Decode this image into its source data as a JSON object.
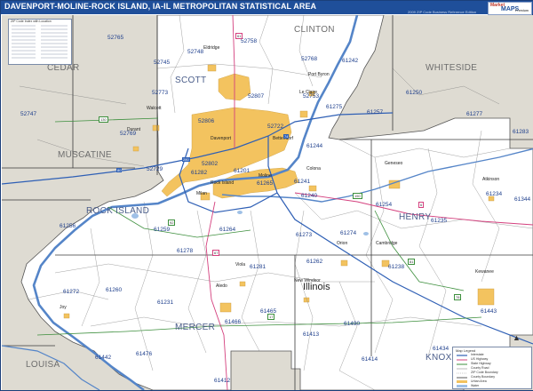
{
  "title": "DAVENPORT-MOLINE-ROCK ISLAND, IA-IL METROPOLITAN STATISTICAL AREA",
  "edition": "2009 ZIP Code Business Reference Edition",
  "logo": {
    "line1": "Market",
    "line2": "MAPS",
    "line3": "Premium"
  },
  "legend_title": "ZIP Code Index with Location",
  "state_label": "Illinois",
  "counties": {
    "outside": [
      "CEDAR",
      "MUSCATINE",
      "CLINTON",
      "WHITESIDE",
      "LOUISA"
    ],
    "inside": [
      "SCOTT",
      "ROCK ISLAND",
      "HENRY",
      "MERCER",
      "KNOX"
    ]
  },
  "zips": [
    "52765",
    "52758",
    "52745",
    "52748",
    "52768",
    "61242",
    "52773",
    "52807",
    "52753",
    "61250",
    "52747",
    "61275",
    "61257",
    "61277",
    "52769",
    "52806",
    "52722",
    "61283",
    "61244",
    "52729",
    "52802",
    "61201",
    "61240",
    "61234",
    "61344",
    "61256",
    "61254",
    "61235",
    "61259",
    "61264",
    "61273",
    "61274",
    "61278",
    "61262",
    "61281",
    "61238",
    "61272",
    "61260",
    "61231",
    "61465",
    "61466",
    "61490",
    "61443",
    "61442",
    "61476",
    "61413",
    "61414",
    "61434",
    "61412",
    "61241",
    "61265",
    "61282"
  ],
  "cities": [
    "Davenport",
    "Moline",
    "Rock Island",
    "Bettendorf",
    "Le Claire",
    "Geneseo",
    "Kewanee",
    "Aledo",
    "Cambridge",
    "Eldridge",
    "Milan",
    "Colona",
    "Port Byron",
    "Walcott",
    "Durant",
    "Orion",
    "Atkinson",
    "Viola",
    "New Windsor",
    "Joy"
  ],
  "roads": [
    "80",
    "74",
    "280",
    "61",
    "67",
    "6",
    "92",
    "150",
    "17",
    "81",
    "78",
    "130"
  ],
  "map_key": {
    "title": "Map Legend",
    "items": [
      "Interstate",
      "US Highway",
      "State Highway",
      "County Road",
      "ZIP Code Boundary",
      "County Boundary",
      "Urban Area",
      "Water"
    ]
  },
  "colors": {
    "title_bar": "#1f4f9a",
    "outside_region": "#dedbd2",
    "inside_region": "#ffffff",
    "urban_area": "#f3c35f",
    "river": "#5585c8",
    "zip_text": "#1d3e8c",
    "interstate": "#2e5fb5",
    "us_highway": "#d4407e",
    "state_highway": "#3d8f3d"
  }
}
